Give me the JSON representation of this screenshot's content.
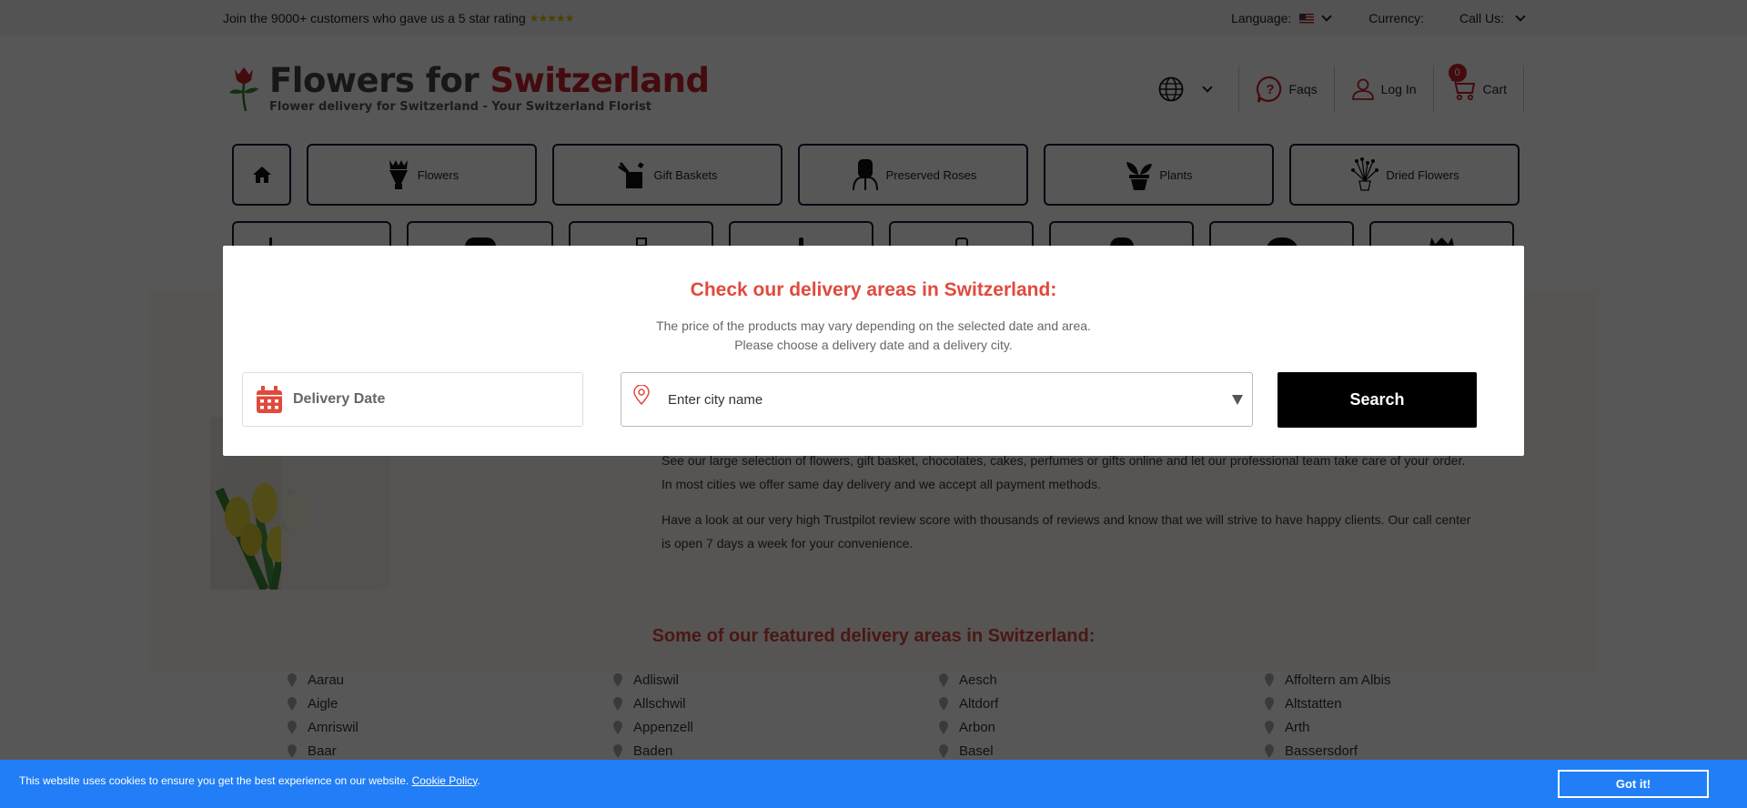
{
  "topbar": {
    "promo": "Join the 9000+ customers who gave us a 5 star rating",
    "stars": "★★★★★",
    "language_label": "Language:",
    "currency_label": "Currency:",
    "call_label": "Call Us:"
  },
  "header": {
    "logo_title_dark": "Flowers for ",
    "logo_title_red": "Switzerland",
    "logo_subtitle": "Flower delivery for Switzerland - Your Switzerland Florist",
    "faqs": "Faqs",
    "login": "Log In",
    "cart": "Cart",
    "cart_count": "0"
  },
  "nav": {
    "row1": [
      {
        "label": "Flowers",
        "icon": "bouquet-icon"
      },
      {
        "label": "Gift Baskets",
        "icon": "gift-icon"
      },
      {
        "label": "Preserved Roses",
        "icon": "preserved-rose-icon"
      },
      {
        "label": "Plants",
        "icon": "plant-icon"
      },
      {
        "label": "Dried Flowers",
        "icon": "dried-flowers-icon"
      }
    ],
    "row2_count": 8
  },
  "modal": {
    "title": "Check our delivery areas in Switzerland:",
    "line1": "The price of the products may vary depending on the selected date and area.",
    "line2": "Please choose a delivery date and a delivery city.",
    "date_label": "Delivery Date",
    "city_placeholder": "Enter city name",
    "search_label": "Search"
  },
  "content": {
    "para1": "See our large selection of flowers, gift basket, chocolates, cakes, perfumes or gifts online and let our professional team take care of your order. In most cities we offer same day delivery and we accept all payment methods.",
    "para2": "Have a look at our very high Trustpilot review score with thousands of reviews and know that we will strive to have happy clients. Our call center is open 7 days a week for your convenience.",
    "featured_title": "Some of our featured delivery areas in Switzerland:",
    "cities": [
      "Aarau",
      "Adliswil",
      "Aesch",
      "Affoltern am Albis",
      "Aigle",
      "Allschwil",
      "Altdorf",
      "Altstatten",
      "Amriswil",
      "Appenzell",
      "Arbon",
      "Arth",
      "Baar",
      "Baden",
      "Basel",
      "Bassersdorf"
    ]
  },
  "cookie": {
    "message": "This website uses cookies to ensure you get the best experience on our website. ",
    "link": "Cookie Policy",
    "button": "Got it!"
  },
  "colors": {
    "brand_red": "#c8202a",
    "modal_title": "#e04a3d",
    "cookie_bar": "#217ef6"
  }
}
